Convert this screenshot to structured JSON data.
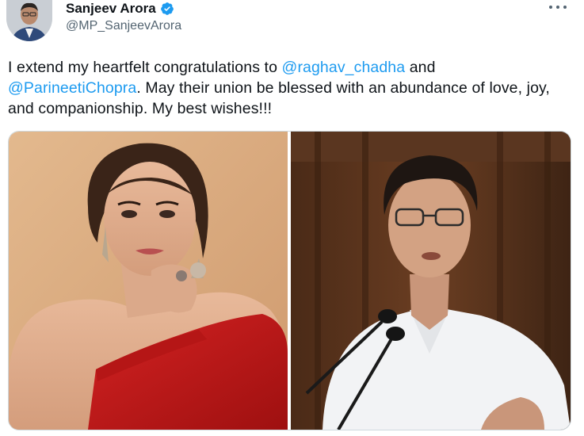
{
  "author": {
    "name": "Sanjeev Arora",
    "handle": "@MP_SanjeevArora",
    "verified": true
  },
  "tweet": {
    "text_1": "I extend my heartfelt congratulations to ",
    "mention_1": "@raghav_chadha",
    "text_2": " and ",
    "mention_2": "@ParineetiChopra",
    "text_3": ". May their union be blessed with an abundance of love, joy, and companionship. My best wishes!!!"
  },
  "icons": {
    "verified": "verified-badge-icon",
    "more": "more-options-icon"
  },
  "colors": {
    "mention": "#1d9bf0",
    "verified": "#1d9bf0",
    "handle": "#536471"
  }
}
